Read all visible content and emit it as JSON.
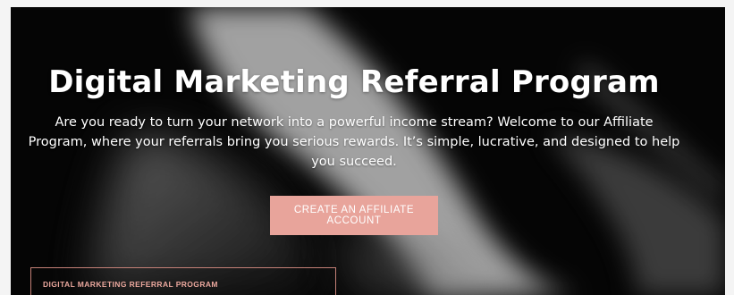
{
  "hero": {
    "title": "Digital Marketing Referral Program",
    "description": "Are you ready to turn your network into a powerful income stream? Welcome to our Affiliate Program, where your referrals bring you serious rewards. It’s simple, lucrative, and designed to help you succeed.",
    "cta_label": "CREATE AN AFFILIATE ACCOUNT"
  },
  "card": {
    "label": "DIGITAL MARKETING REFERRAL PROGRAM"
  },
  "colors": {
    "background": "#070707",
    "accent": "#e8a49b",
    "card_border": "#c48077",
    "card_text": "#eaa79d",
    "text": "#ffffff"
  }
}
